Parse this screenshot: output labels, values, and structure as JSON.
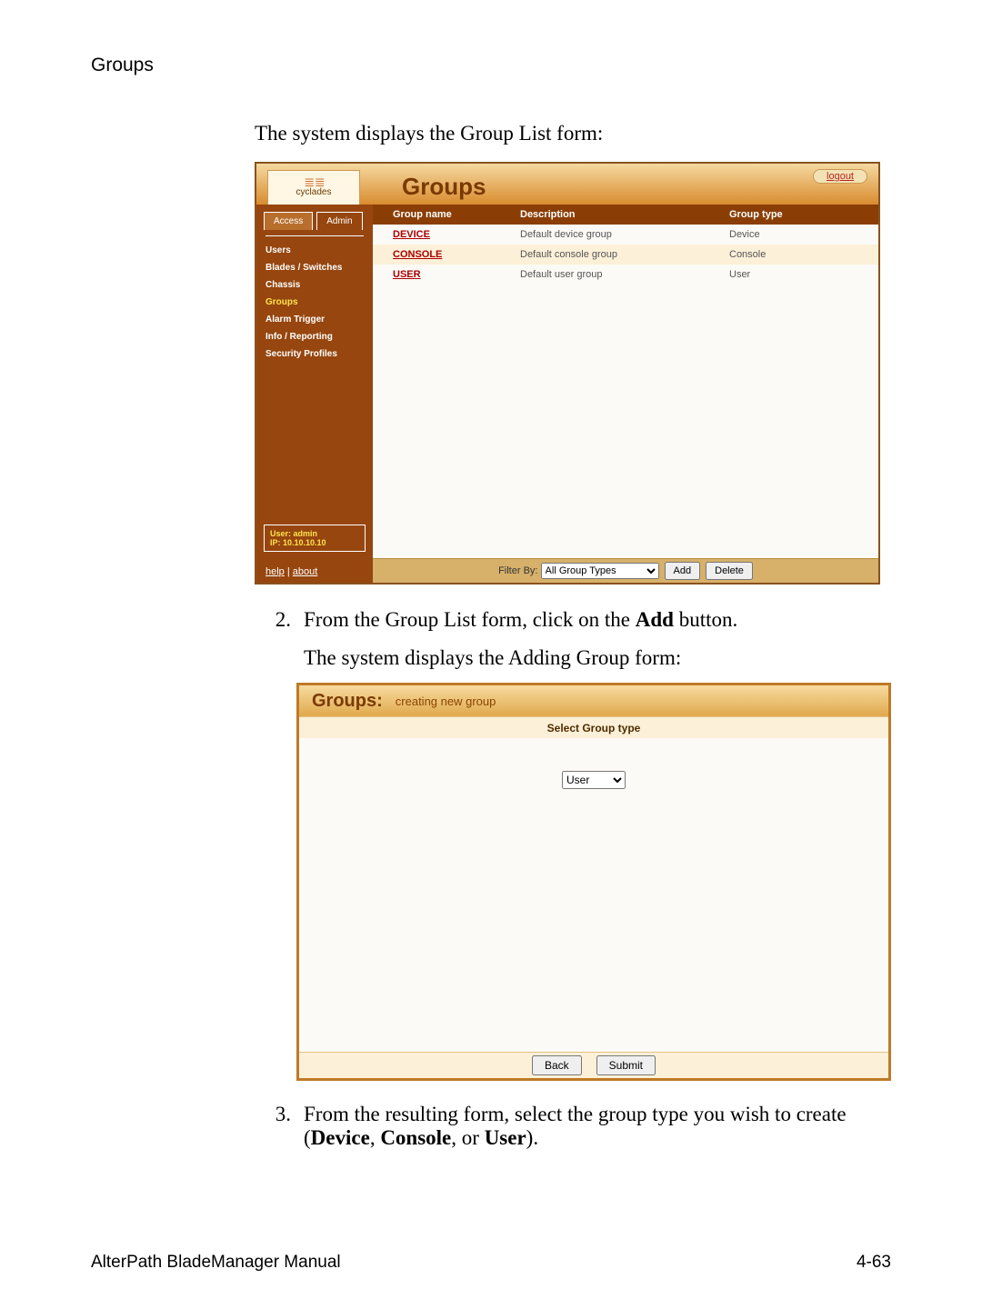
{
  "running_head": "Groups",
  "intro": "The system displays the Group List form:",
  "shot1": {
    "brand": "cyclades",
    "title": "Groups",
    "logout": "logout",
    "tabs": {
      "access": "Access",
      "admin": "Admin"
    },
    "side": {
      "users": "Users",
      "blades": "Blades / Switches",
      "chassis": "Chassis",
      "groups": "Groups",
      "alarm": "Alarm Trigger",
      "info": "Info / Reporting",
      "security": "Security Profiles"
    },
    "userbox_line1": "User: admin",
    "userbox_line2": "IP: 10.10.10.10",
    "help": "help",
    "about": "about",
    "th": {
      "name": "Group name",
      "desc": "Description",
      "type": "Group type"
    },
    "rows": [
      {
        "name": "DEVICE",
        "desc": "Default device group",
        "type": "Device"
      },
      {
        "name": "CONSOLE",
        "desc": "Default console group",
        "type": "Console"
      },
      {
        "name": "USER",
        "desc": "Default user group",
        "type": "User"
      }
    ],
    "filter_label": "Filter By:",
    "filter_value": "All Group Types",
    "add": "Add",
    "delete": "Delete"
  },
  "step2_num": "2.",
  "step2_a": "From the Group List form, click on the ",
  "step2_b": "Add",
  "step2_c": " button.",
  "subline": "The system displays the Adding Group form:",
  "shot2": {
    "title": "Groups:",
    "subtitle": "creating new group",
    "bar": "Select Group type",
    "select_value": "User",
    "back": "Back",
    "submit": "Submit"
  },
  "step3_num": "3.",
  "step3_a": "From the resulting form, select the group type you wish to create (",
  "step3_b": "Device",
  "step3_c": ", ",
  "step3_d": "Console",
  "step3_e": ", or ",
  "step3_f": "User",
  "step3_g": ").",
  "footer_left": "AlterPath BladeManager Manual",
  "footer_right": "4-63"
}
